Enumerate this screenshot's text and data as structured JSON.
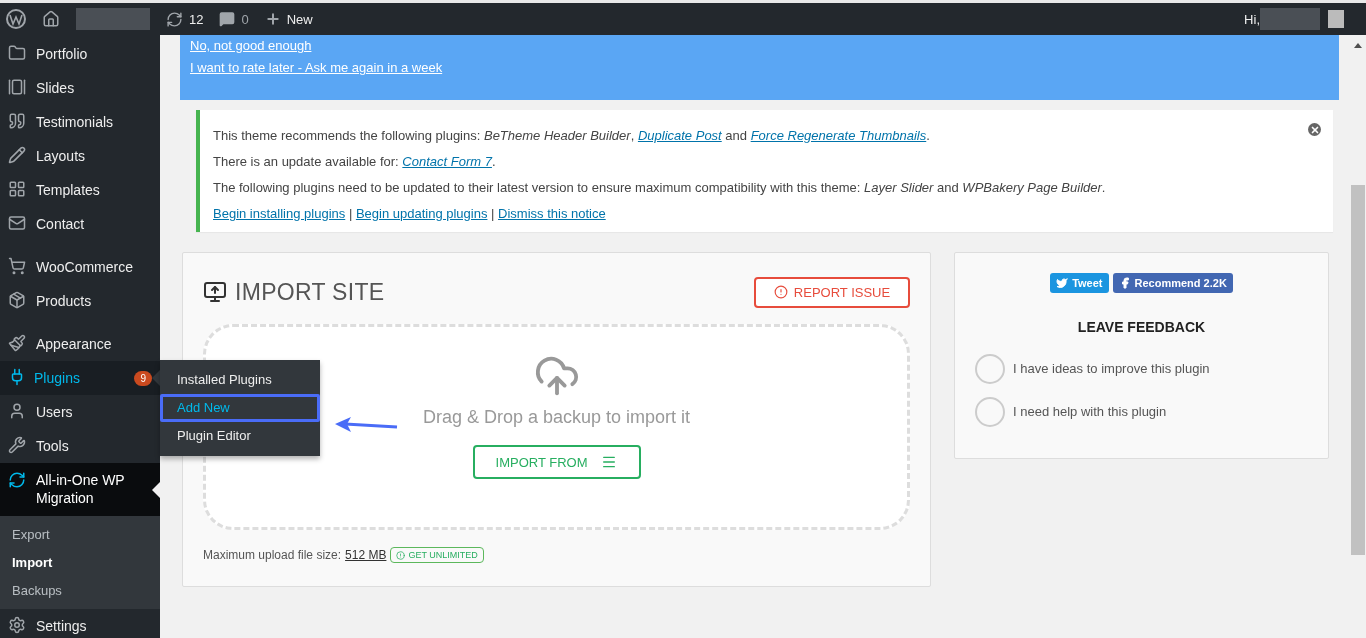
{
  "admin_bar": {
    "updates_count": "12",
    "comments_count": "0",
    "new_label": "New",
    "greeting": "Hi,"
  },
  "sidebar": {
    "groups": [
      [
        {
          "label": "Portfolio",
          "hovered": false,
          "current": false
        },
        {
          "label": "Slides",
          "hovered": false,
          "current": false
        },
        {
          "label": "Testimonials",
          "hovered": false,
          "current": false
        },
        {
          "label": "Layouts",
          "hovered": false,
          "current": false
        },
        {
          "label": "Templates",
          "hovered": false,
          "current": false
        },
        {
          "label": "Contact",
          "hovered": false,
          "current": false
        }
      ],
      [
        {
          "label": "WooCommerce",
          "hovered": false,
          "current": false
        },
        {
          "label": "Products",
          "hovered": false,
          "current": false
        }
      ],
      [
        {
          "label": "Appearance",
          "hovered": false,
          "current": false
        },
        {
          "label": "Plugins",
          "badge": "9",
          "hovered": true,
          "current": false
        },
        {
          "label": "Users",
          "hovered": false,
          "current": false
        },
        {
          "label": "Tools",
          "hovered": false,
          "current": false
        },
        {
          "label": "All-in-One WP Migration",
          "hovered": false,
          "current": true
        }
      ]
    ],
    "submenu": [
      {
        "label": "Export",
        "selected": false
      },
      {
        "label": "Import",
        "selected": true
      },
      {
        "label": "Backups",
        "selected": false
      }
    ],
    "after": [
      {
        "label": "Settings",
        "hovered": false,
        "current": false
      }
    ]
  },
  "flyout_menu": [
    {
      "label": "Installed Plugins",
      "highlighted": false
    },
    {
      "label": "Add New",
      "highlighted": true
    },
    {
      "label": "Plugin Editor",
      "highlighted": false
    }
  ],
  "rating_banner": {
    "links": [
      "No, not good enough",
      "I want to rate later - Ask me again in a week"
    ]
  },
  "notice": {
    "lines": [
      [
        {
          "kind": "text",
          "text": "This theme recommends the following plugins: "
        },
        {
          "kind": "italic",
          "text": "BeTheme Header Builder"
        },
        {
          "kind": "text",
          "text": ", "
        },
        {
          "kind": "link",
          "text": "Duplicate Post"
        },
        {
          "kind": "text",
          "text": " and "
        },
        {
          "kind": "link",
          "text": "Force Regenerate Thumbnails"
        },
        {
          "kind": "text",
          "text": "."
        }
      ],
      [
        {
          "kind": "text",
          "text": "There is an update available for: "
        },
        {
          "kind": "link",
          "text": "Contact Form 7"
        },
        {
          "kind": "text",
          "text": "."
        }
      ],
      [
        {
          "kind": "text",
          "text": "The following plugins need to be updated to their latest version to ensure maximum compatibility with this theme: "
        },
        {
          "kind": "italic",
          "text": "Layer Slider"
        },
        {
          "kind": "text",
          "text": " and "
        },
        {
          "kind": "italic",
          "text": "WPBakery Page Builder"
        },
        {
          "kind": "text",
          "text": "."
        }
      ],
      [
        {
          "kind": "action",
          "text": "Begin installing plugins"
        },
        {
          "kind": "text",
          "text": " | "
        },
        {
          "kind": "action",
          "text": "Begin updating plugins"
        },
        {
          "kind": "text",
          "text": " | "
        },
        {
          "kind": "action",
          "text": "Dismiss this notice"
        }
      ]
    ]
  },
  "import_panel": {
    "title": "IMPORT SITE",
    "report_button": "REPORT ISSUE",
    "drop_text": "Drag & Drop a backup to import it",
    "import_button": "IMPORT FROM",
    "max_size_label": "Maximum upload file size: ",
    "max_size_value": "512 MB",
    "unlimited_badge": "GET UNLIMITED"
  },
  "feedback_panel": {
    "tweet_button": "Tweet",
    "recommend_button": "Recommend 2.2K",
    "title": "LEAVE FEEDBACK",
    "options": [
      {
        "label": "I have ideas to improve this plugin",
        "selected": false
      },
      {
        "label": "I need help with this plugin",
        "selected": false
      }
    ]
  }
}
